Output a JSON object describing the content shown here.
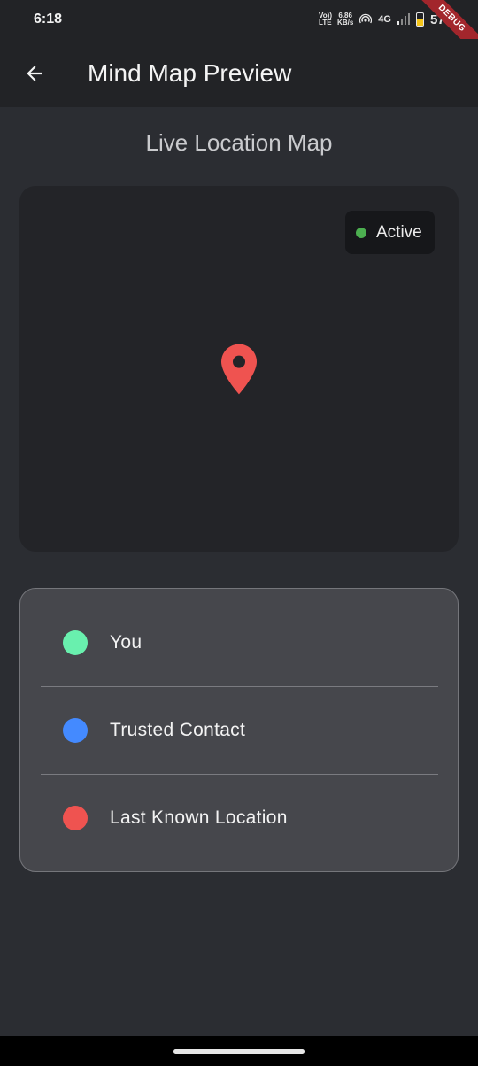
{
  "status_bar": {
    "time": "6:18",
    "volte": "Vo)) LTE",
    "speed_value": "6.86",
    "speed_unit": "KB/s",
    "network": "4G",
    "battery_percent": "57%",
    "battery_level": 0.57,
    "battery_color": "#f5c518"
  },
  "debug_banner": "DEBUG",
  "app_bar": {
    "title": "Mind Map Preview",
    "back_icon": "arrow-back-icon"
  },
  "section_title": "Live Location Map",
  "map": {
    "status_label": "Active",
    "status_color": "#4caf50",
    "pin_icon": "location-pin-icon",
    "pin_color": "#ef5350"
  },
  "legend": {
    "items": [
      {
        "label": "You",
        "color": "#69f0ae"
      },
      {
        "label": "Trusted Contact",
        "color": "#448aff"
      },
      {
        "label": "Last Known Location",
        "color": "#ef5350"
      }
    ]
  }
}
